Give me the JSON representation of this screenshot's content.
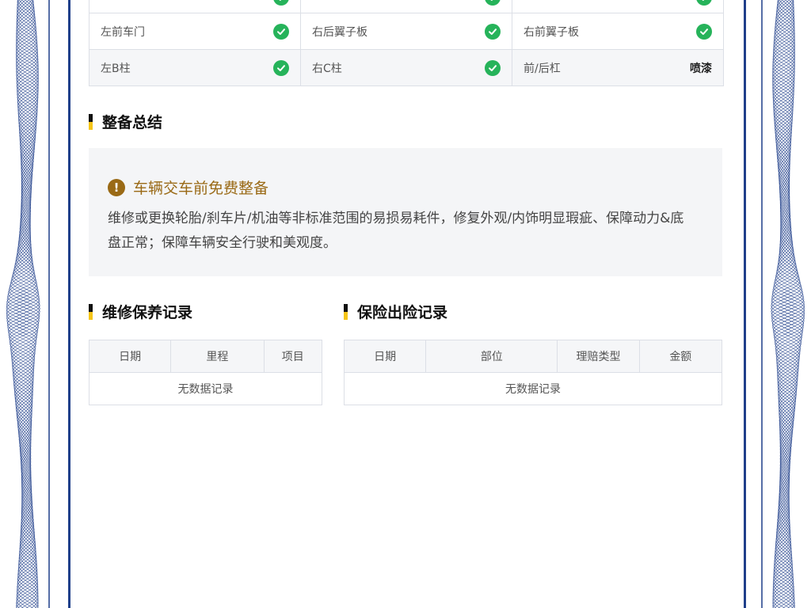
{
  "inspection_grid": {
    "rows": [
      {
        "cells": [
          {
            "label": "",
            "status": "ok"
          },
          {
            "label": "",
            "status": "ok"
          },
          {
            "label": "",
            "status": "ok"
          }
        ]
      },
      {
        "cells": [
          {
            "label": "左前车门",
            "status": "ok"
          },
          {
            "label": "右后翼子板",
            "status": "ok"
          },
          {
            "label": "右前翼子板",
            "status": "ok"
          }
        ]
      },
      {
        "cells": [
          {
            "label": "左B柱",
            "status": "ok"
          },
          {
            "label": "右C柱",
            "status": "ok"
          },
          {
            "label": "前/后杠",
            "status": "text",
            "status_text": "喷漆"
          }
        ]
      }
    ]
  },
  "summary": {
    "section_title": "整备总结",
    "notice_title": "车辆交车前免费整备",
    "notice_body": "维修或更换轮胎/刹车片/机油等非标准范围的易损易耗件，修复外观/内饰明显瑕疵、保障动力&底盘正常；保障车辆安全行驶和美观度。"
  },
  "maintenance": {
    "section_title": "维修保养记录",
    "columns": [
      "日期",
      "里程",
      "项目"
    ],
    "empty_text": "无数据记录"
  },
  "insurance": {
    "section_title": "保险出险记录",
    "columns": [
      "日期",
      "部位",
      "理赔类型",
      "金额"
    ],
    "empty_text": "无数据记录"
  },
  "colors": {
    "accent_yellow": "#f5c518",
    "frame_blue": "#1f3f8a",
    "ok_green": "#26b35a",
    "notice_brown": "#9a6a16"
  },
  "icons": {
    "ok": "check-circle-icon",
    "notice": "exclamation-circle-icon"
  }
}
